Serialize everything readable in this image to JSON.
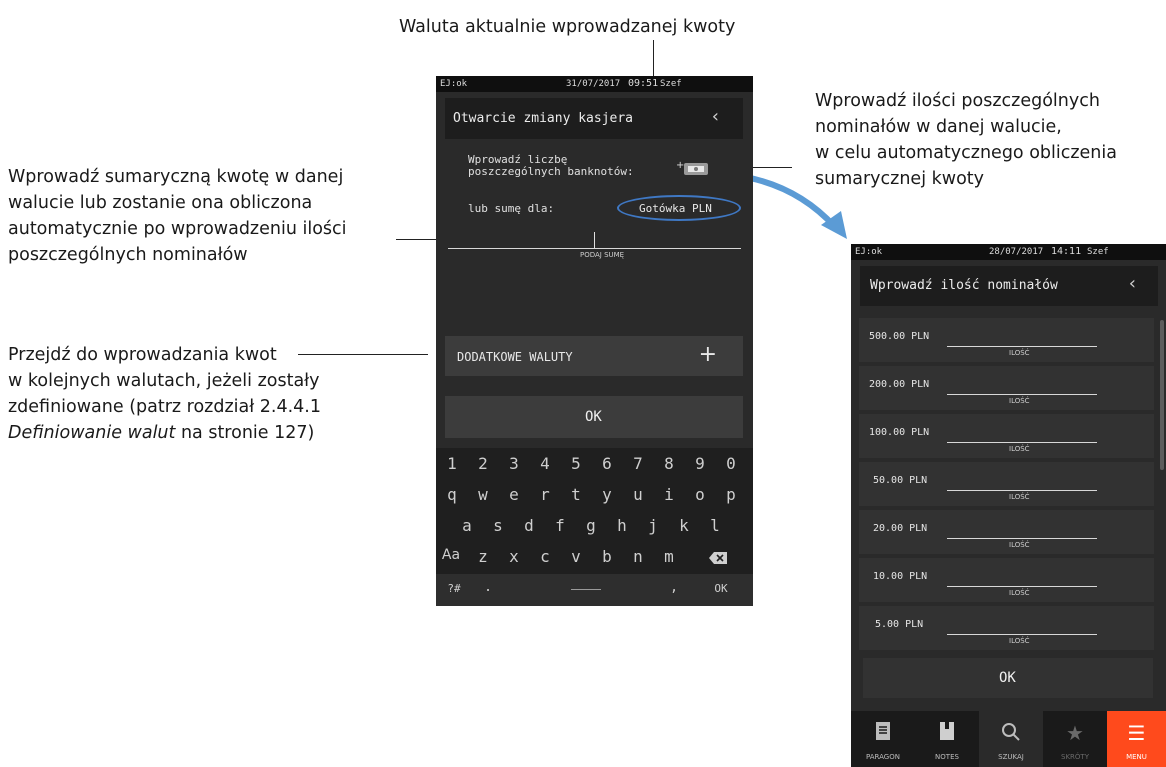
{
  "annotations": {
    "currency_label": "Waluta aktualnie wprowadzanej kwoty",
    "denominations": [
      "Wprowadź ilości poszczególnych",
      "nominałów w danej walucie,",
      "w celu automatycznego obliczenia",
      "sumarycznej kwoty"
    ],
    "sum": [
      "Wprowadź sumaryczną kwotę w danej",
      "walucie lub zostanie ona obliczona",
      "automatycznie po wprowadzeniu ilości",
      "poszczególnych nominałów"
    ],
    "more_currencies": [
      "Przejdź do wprowadzania kwot",
      "w kolejnych walutach, jeżeli zostały",
      "zdefiniowane (patrz rozdział 2.4.4.1"
    ],
    "more_currencies_ref": "Definiowanie walut",
    "more_currencies_page": " na stronie 127)"
  },
  "screen1": {
    "status": {
      "left": "EJ:ok",
      "date": "31/07/2017",
      "time": "09:51",
      "user": "Szef"
    },
    "title": "Otwarcie zmiany kasjera",
    "back_icon": "chevron-left-icon",
    "banknotes_prompt": [
      "Wprowadź liczbę",
      "poszczególnych banknotów:"
    ],
    "banknotes_icon": "add-banknotes-icon",
    "sum_for_label": "lub sumę dla:",
    "currency_button": "Gotówka PLN",
    "sum_caption": "PODAJ SUMĘ",
    "extra_currencies_label": "DODATKOWE WALUTY",
    "plus_icon": "plus-icon",
    "ok_label": "OK",
    "keyboard": {
      "row1": [
        "1",
        "2",
        "3",
        "4",
        "5",
        "6",
        "7",
        "8",
        "9",
        "0"
      ],
      "row2": [
        "q",
        "w",
        "e",
        "r",
        "t",
        "y",
        "u",
        "i",
        "o",
        "p"
      ],
      "row3": [
        "a",
        "s",
        "d",
        "f",
        "g",
        "h",
        "j",
        "k",
        "l"
      ],
      "row4": [
        "Aa",
        "z",
        "x",
        "c",
        "v",
        "b",
        "n",
        "m"
      ],
      "symbols": "?#",
      "dot": ".",
      "comma": ",",
      "ok": "OK",
      "backspace_icon": "backspace-icon"
    }
  },
  "screen2": {
    "status": {
      "left": "EJ:ok",
      "date": "28/07/2017",
      "time": "14:11",
      "user": "Szef"
    },
    "title": "Wprowadź ilość nominałów",
    "back_icon": "chevron-left-icon",
    "qty_caption": "ILOŚĆ",
    "rows": [
      "500.00 PLN",
      "200.00 PLN",
      "100.00 PLN",
      "50.00 PLN",
      "20.00 PLN",
      "10.00 PLN",
      "5.00 PLN"
    ],
    "ok_label": "OK",
    "nav": [
      {
        "label": "PARAGON",
        "icon": "receipt-icon"
      },
      {
        "label": "NOTES",
        "icon": "notebook-icon"
      },
      {
        "label": "SZUKAJ",
        "icon": "search-icon"
      },
      {
        "label": "SKRÓTY",
        "icon": "star-icon"
      },
      {
        "label": "MENU",
        "icon": "menu-icon"
      }
    ],
    "menu_active_color": "#ff4a1c"
  }
}
